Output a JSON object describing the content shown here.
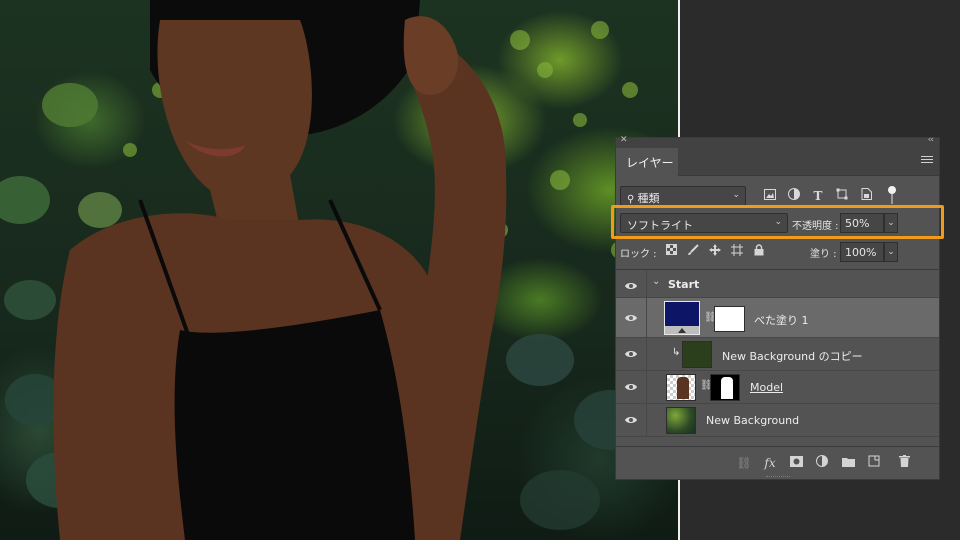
{
  "layers_panel": {
    "tab_label": "レイヤー",
    "filter": {
      "selected": "種類"
    },
    "blend_mode": {
      "selected": "ソフトライト"
    },
    "opacity": {
      "label": "不透明度 :",
      "value": "50%"
    },
    "lock": {
      "label": "ロック :"
    },
    "fill": {
      "label": "塗り :",
      "value": "100%"
    },
    "layers": [
      {
        "name": "Start",
        "type": "group",
        "expanded": true
      },
      {
        "name": "べた塗り 1",
        "type": "solid-color-fill",
        "color": "#0d1566",
        "selected": true
      },
      {
        "name": "New Background のコピー",
        "type": "clipped-layer",
        "color": "#2c3f1d"
      },
      {
        "name": "Model",
        "type": "masked-layer"
      },
      {
        "name": "New Background",
        "type": "layer"
      }
    ]
  },
  "colors": {
    "highlight": "#f29a1a",
    "panel_bg": "#535353",
    "selected_row": "#6a6a6a"
  }
}
